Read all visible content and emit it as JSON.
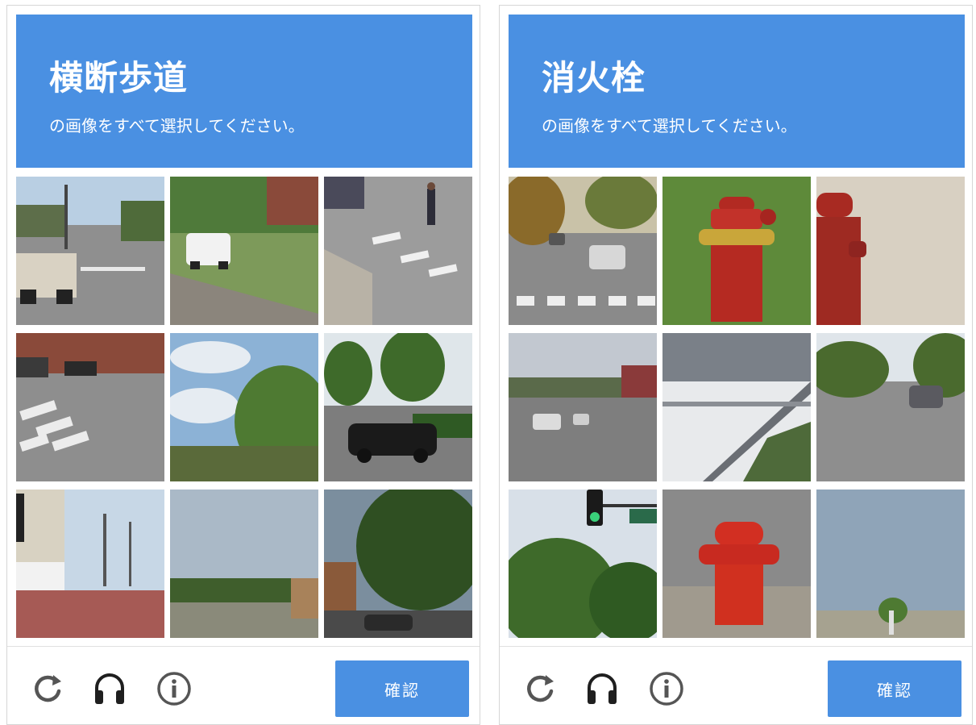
{
  "challenges": [
    {
      "keyword": "横断歩道",
      "instruction": "の画像をすべて選択してください。",
      "verify_label": "確認",
      "tiles": [
        "street-with-truck",
        "road-with-white-van",
        "crosswalk-with-pedestrian",
        "crosswalk-street",
        "sky-and-trees",
        "parked-black-car",
        "building-and-power-lines",
        "empty-field",
        "trees-and-houses"
      ]
    },
    {
      "keyword": "消火栓",
      "instruction": "の画像をすべて選択してください。",
      "verify_label": "確認",
      "tiles": [
        "road-with-cars",
        "red-fire-hydrant",
        "red-fire-hydrant-on-sidewalk",
        "city-street",
        "overpass-structure",
        "residential-street",
        "traffic-light",
        "red-fire-hydrant-closeup",
        "sky-and-horizon"
      ]
    }
  ],
  "icons": [
    "reload-icon",
    "headphones-icon",
    "info-icon"
  ],
  "colors": {
    "accent": "#4a90e2",
    "text_on_accent": "#ffffff",
    "icon": "#555555"
  }
}
